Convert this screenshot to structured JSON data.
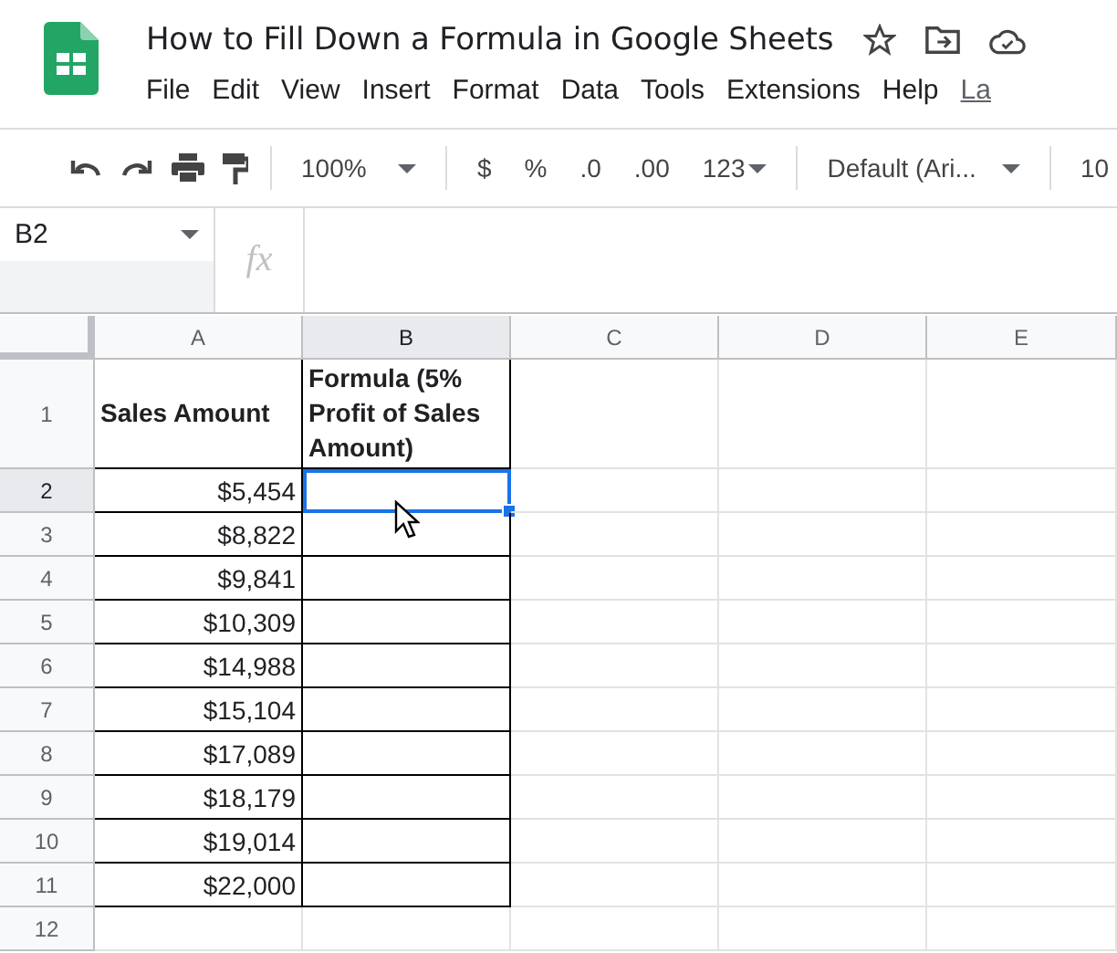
{
  "doc": {
    "title": "How to Fill Down a Formula in Google Sheets",
    "menu": [
      "File",
      "Edit",
      "View",
      "Insert",
      "Format",
      "Data",
      "Tools",
      "Extensions",
      "Help"
    ],
    "last_edit": "La"
  },
  "toolbar": {
    "zoom": "100%",
    "currency": "$",
    "percent": "%",
    "decrease_decimals": ".0",
    "increase_decimals": ".00",
    "more_formats": "123",
    "font": "Default (Ari...",
    "font_size": "10"
  },
  "formula_bar": {
    "name_box": "B2",
    "fx": "fx"
  },
  "columns": [
    {
      "label": "A",
      "selected": false
    },
    {
      "label": "B",
      "selected": true
    },
    {
      "label": "C",
      "selected": false
    },
    {
      "label": "D",
      "selected": false
    },
    {
      "label": "E",
      "selected": false
    }
  ],
  "rows": [
    {
      "number": "1",
      "selected": false,
      "kind": "header",
      "cells": [
        {
          "text": "Sales Amount",
          "selected": false
        },
        {
          "text": "Formula (5% Profit of Sales Amount)",
          "selected": false
        }
      ]
    },
    {
      "number": "2",
      "selected": true,
      "kind": "data",
      "cells": [
        {
          "text": "$5,454",
          "selected": false
        },
        {
          "selected": true
        }
      ]
    },
    {
      "number": "3",
      "selected": false,
      "kind": "data",
      "cells": [
        {
          "text": "$8,822",
          "selected": false
        },
        {
          "selected": false
        }
      ]
    },
    {
      "number": "4",
      "selected": false,
      "kind": "data",
      "cells": [
        {
          "text": "$9,841",
          "selected": false
        },
        {
          "selected": false
        }
      ]
    },
    {
      "number": "5",
      "selected": false,
      "kind": "data",
      "cells": [
        {
          "text": "$10,309",
          "selected": false
        },
        {
          "selected": false
        }
      ]
    },
    {
      "number": "6",
      "selected": false,
      "kind": "data",
      "cells": [
        {
          "text": "$14,988",
          "selected": false
        },
        {
          "selected": false
        }
      ]
    },
    {
      "number": "7",
      "selected": false,
      "kind": "data",
      "cells": [
        {
          "text": "$15,104",
          "selected": false
        },
        {
          "selected": false
        }
      ]
    },
    {
      "number": "8",
      "selected": false,
      "kind": "data",
      "cells": [
        {
          "text": "$17,089",
          "selected": false
        },
        {
          "selected": false
        }
      ]
    },
    {
      "number": "9",
      "selected": false,
      "kind": "data",
      "cells": [
        {
          "text": "$18,179",
          "selected": false
        },
        {
          "selected": false
        }
      ]
    },
    {
      "number": "10",
      "selected": false,
      "kind": "data",
      "cells": [
        {
          "text": "$19,014",
          "selected": false
        },
        {
          "selected": false
        }
      ]
    },
    {
      "number": "11",
      "selected": false,
      "kind": "data",
      "cells": [
        {
          "text": "$22,000",
          "selected": false
        },
        {
          "selected": false
        }
      ]
    },
    {
      "number": "12",
      "selected": false,
      "kind": "empty"
    }
  ]
}
